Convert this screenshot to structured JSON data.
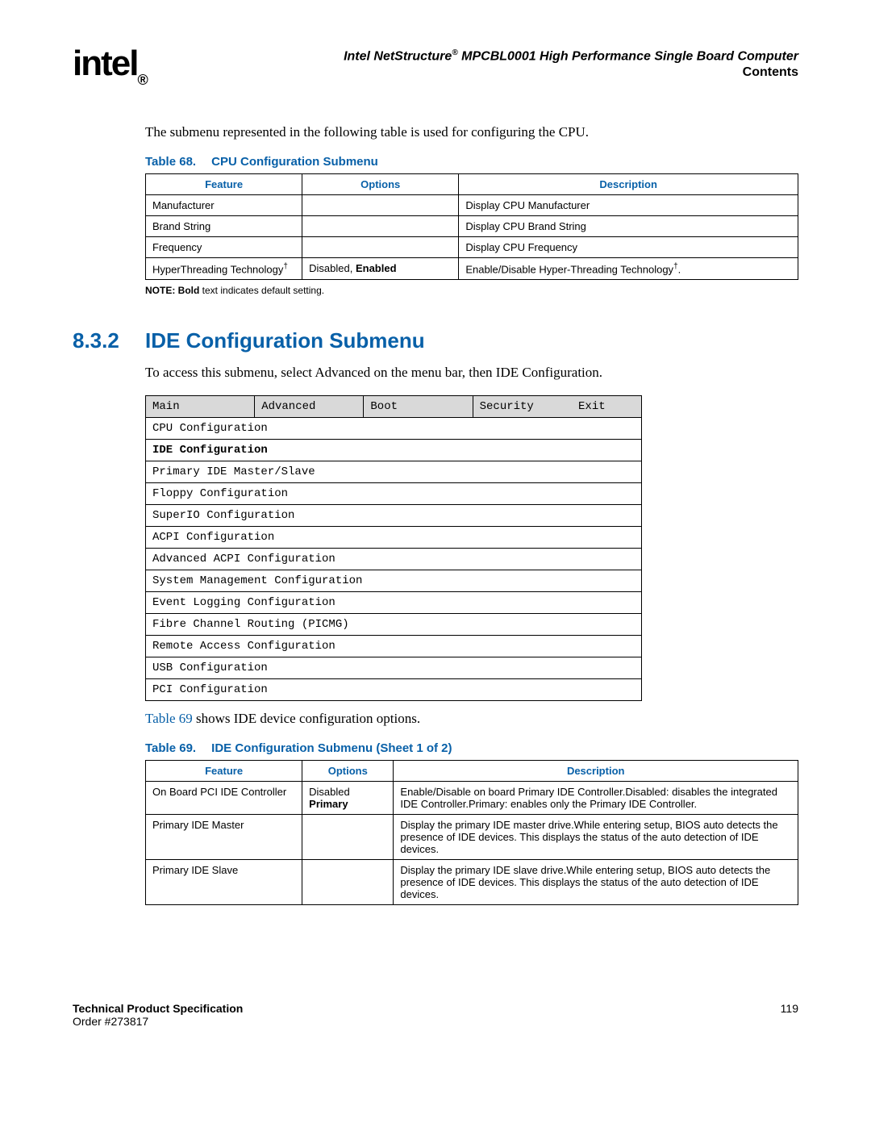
{
  "header": {
    "logo_text": "intel",
    "logo_reg": "®",
    "title_prefix": "Intel NetStructure",
    "title_sup": "®",
    "title_suffix": " MPCBL0001 High Performance Single Board Computer",
    "subtitle": "Contents"
  },
  "intro_paragraph": "The submenu represented in the following table is used for configuring the CPU.",
  "table68": {
    "label_num": "Table 68.",
    "label_title": "CPU Configuration Submenu",
    "headers": [
      "Feature",
      "Options",
      "Description"
    ],
    "rows": [
      {
        "feature": "Manufacturer",
        "options": "",
        "description": "Display CPU Manufacturer"
      },
      {
        "feature": "Brand String",
        "options": "",
        "description": "Display CPU Brand String"
      },
      {
        "feature": "Frequency",
        "options": "",
        "description": "Display CPU Frequency"
      },
      {
        "feature_prefix": "HyperThreading Technology",
        "feature_sup": "†",
        "options_plain": "Disabled, ",
        "options_bold": "Enabled",
        "desc_prefix": "Enable/Disable Hyper-Threading Technology",
        "desc_sup": "†",
        "desc_suffix": "."
      }
    ],
    "note_prefix": "NOTE:  ",
    "note_bold": "Bold",
    "note_suffix": " text indicates default setting."
  },
  "section": {
    "number": "8.3.2",
    "title": "IDE Configuration Submenu",
    "paragraph": "To access this submenu, select Advanced on the menu bar, then IDE Configuration."
  },
  "menu": {
    "tabs": [
      "Main",
      "Advanced",
      "Boot",
      "Security",
      "Exit"
    ],
    "items": [
      {
        "label": "CPU Configuration",
        "selected": false
      },
      {
        "label": "IDE Configuration",
        "selected": true
      },
      {
        "label": "Primary IDE Master/Slave",
        "selected": false
      },
      {
        "label": "Floppy Configuration",
        "selected": false
      },
      {
        "label": "SuperIO Configuration",
        "selected": false
      },
      {
        "label": "ACPI Configuration",
        "selected": false
      },
      {
        "label": "Advanced ACPI Configuration",
        "selected": false
      },
      {
        "label": "System Management Configuration",
        "selected": false
      },
      {
        "label": "Event Logging Configuration",
        "selected": false
      },
      {
        "label": "Fibre Channel Routing (PICMG)",
        "selected": false
      },
      {
        "label": "Remote Access Configuration",
        "selected": false
      },
      {
        "label": "USB Configuration",
        "selected": false
      },
      {
        "label": "PCI Configuration",
        "selected": false
      }
    ]
  },
  "after_menu_xref": "Table 69",
  "after_menu_text": " shows IDE device configuration options.",
  "table69": {
    "label_num": "Table 69.",
    "label_title": "IDE Configuration Submenu (Sheet 1 of 2)",
    "headers": [
      "Feature",
      "Options",
      "Description"
    ],
    "rows": [
      {
        "feature": "On Board PCI IDE Controller",
        "options_plain": "Disabled",
        "options_bold": "Primary",
        "description": "Enable/Disable on board Primary IDE Controller.Disabled: disables the integrated IDE Controller.Primary: enables only the Primary IDE Controller."
      },
      {
        "feature": "Primary IDE Master",
        "options_plain": "",
        "options_bold": "",
        "description": "Display the primary IDE master drive.While entering setup, BIOS auto detects the presence of IDE devices. This displays the status of the auto detection of IDE devices."
      },
      {
        "feature": "Primary IDE Slave",
        "options_plain": "",
        "options_bold": "",
        "description": "Display the primary IDE slave drive.While entering setup, BIOS auto detects the presence of IDE devices. This displays the status of the auto detection of IDE devices."
      }
    ]
  },
  "footer": {
    "title": "Technical Product Specification",
    "order": "Order #273817",
    "page": "119"
  }
}
